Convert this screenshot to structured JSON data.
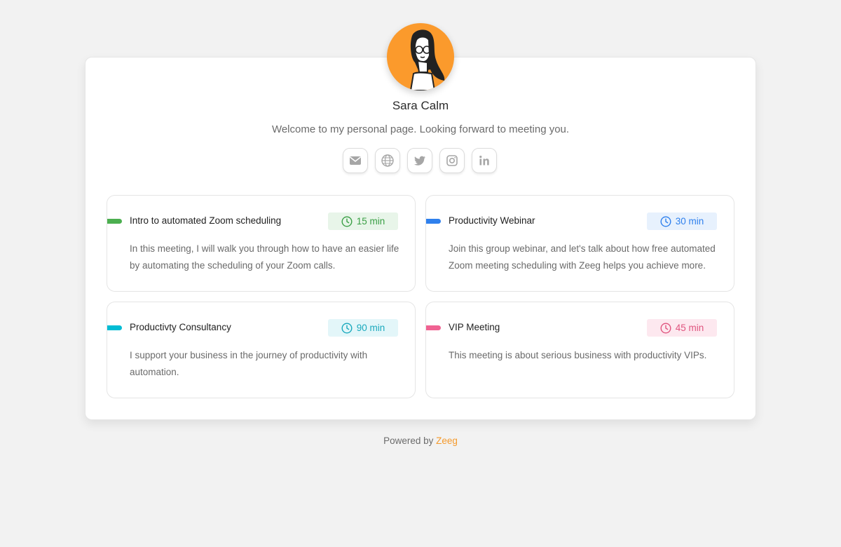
{
  "profile": {
    "name": "Sara Calm",
    "welcome": "Welcome to my personal page. Looking forward to meeting you.",
    "avatar_color": "#fb9a2c"
  },
  "socials": [
    {
      "icon": "email-icon"
    },
    {
      "icon": "globe-icon"
    },
    {
      "icon": "twitter-icon"
    },
    {
      "icon": "instagram-icon"
    },
    {
      "icon": "linkedin-icon"
    }
  ],
  "events": [
    {
      "title": "Intro to automated Zoom scheduling",
      "duration": "15 min",
      "description": "In this meeting, I will walk you through how to have an easier life by automating the scheduling of your Zoom calls.",
      "accent": "#4caf50",
      "badge_bg": "#e8f5e9",
      "badge_fg": "#3a9f45"
    },
    {
      "title": "Productivity Webinar",
      "duration": "30 min",
      "description": "Join this group webinar, and let's talk about how free automated Zoom meeting scheduling with Zeeg helps you achieve more.",
      "accent": "#2f80ed",
      "badge_bg": "#e7f1fd",
      "badge_fg": "#2f80ed"
    },
    {
      "title": "Productivty Consultancy",
      "duration": "90 min",
      "description": "I support your business in the journey of productivity with automation.",
      "accent": "#00bcd4",
      "badge_bg": "#e3f6f9",
      "badge_fg": "#19a9bd"
    },
    {
      "title": "VIP Meeting",
      "duration": "45 min",
      "description": "This meeting is about serious business with productivity VIPs.",
      "accent": "#f06292",
      "badge_bg": "#fde8ef",
      "badge_fg": "#e0557f"
    }
  ],
  "footer": {
    "powered_by": "Powered by",
    "brand": "Zeeg",
    "brand_color": "#f59a2c"
  }
}
